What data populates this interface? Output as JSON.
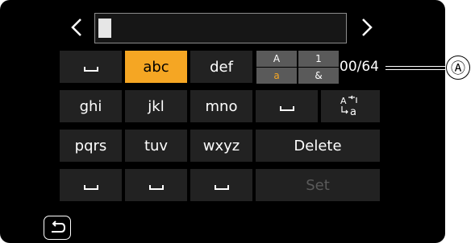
{
  "text_entry": {
    "value": "",
    "left_arrow_icon": "chevron-left-icon",
    "right_arrow_icon": "chevron-right-icon"
  },
  "keyboard": {
    "row1": {
      "k1": "space",
      "k2": "abc",
      "k3": "def"
    },
    "row2": {
      "k1": "ghi",
      "k2": "jkl",
      "k3": "mno",
      "k4": "space",
      "k5_icon": "case-toggle-icon"
    },
    "row3": {
      "k1": "pqrs",
      "k2": "tuv",
      "k3": "wxyz",
      "delete": "Delete"
    },
    "row4": {
      "k1": "space",
      "k2": "space",
      "k3": "space",
      "set": "Set"
    },
    "selected_key": "abc"
  },
  "input_mode": {
    "upper": "A",
    "number": "1",
    "lower": "a",
    "symbol": "&",
    "active": "a"
  },
  "char_counter": "00/64",
  "callout_marker": "Ⓐ",
  "back_icon": "return-icon",
  "colors": {
    "selected": "#f5a623",
    "key": "#222222",
    "background": "#000000"
  }
}
